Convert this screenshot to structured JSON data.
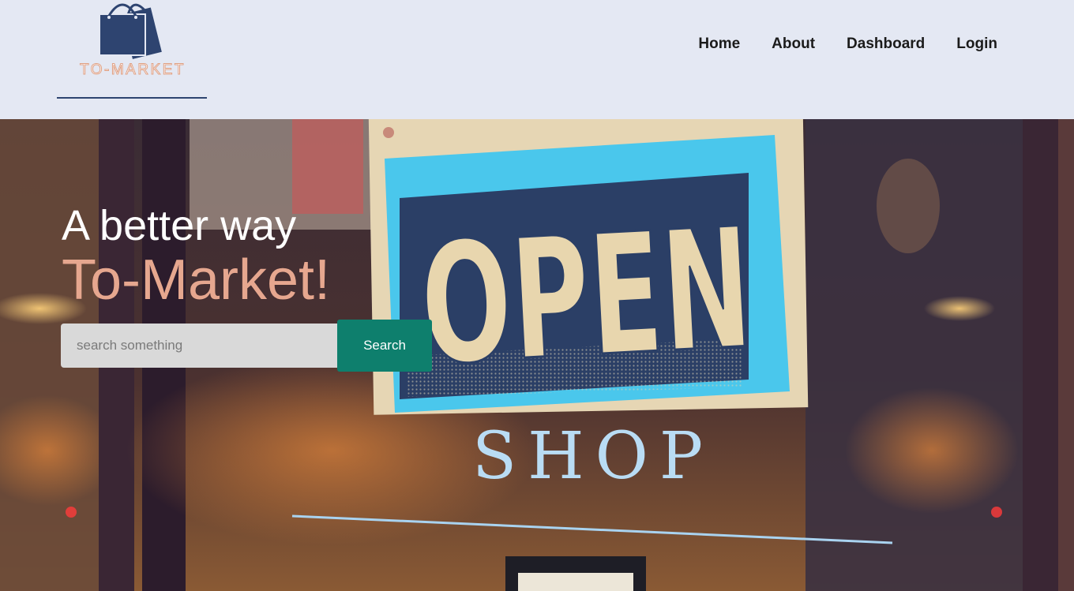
{
  "brand": {
    "name": "TO-MARKET"
  },
  "nav": {
    "items": [
      {
        "label": "Home"
      },
      {
        "label": "About"
      },
      {
        "label": "Dashboard"
      },
      {
        "label": "Login"
      }
    ]
  },
  "hero": {
    "headline_line1": "A better way",
    "headline_line2": "To-Market!",
    "search": {
      "placeholder": "search something",
      "value": "",
      "button_label": "Search"
    },
    "background_sign": {
      "sign_text": "OPEN",
      "door_text": "SHOP"
    }
  },
  "colors": {
    "header_bg": "#e4e8f3",
    "brand_navy": "#2e4470",
    "brand_peach": "#e6a78f",
    "search_button": "#0e7f6d"
  }
}
